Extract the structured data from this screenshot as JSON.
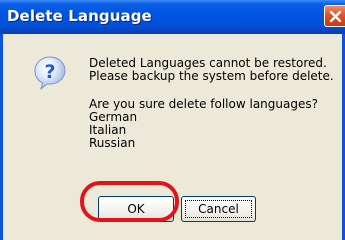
{
  "window": {
    "title": "Delete Language"
  },
  "icons": {
    "title_close": "close-icon",
    "message": "question-icon"
  },
  "message": {
    "lines": [
      "Deleted Languages cannot be restored.",
      "Please backup the system before delete.",
      "Are you sure delete follow languages?",
      "German",
      "Italian",
      "Russian"
    ]
  },
  "buttons": {
    "ok_label": "OK",
    "cancel_label": "Cancel"
  },
  "colors": {
    "titlebar": "#0054e3",
    "close": "#e2522a",
    "dialog_bg": "#ece9d8",
    "highlight": "#e3131b",
    "icon_blue": "#1f5bd6"
  }
}
